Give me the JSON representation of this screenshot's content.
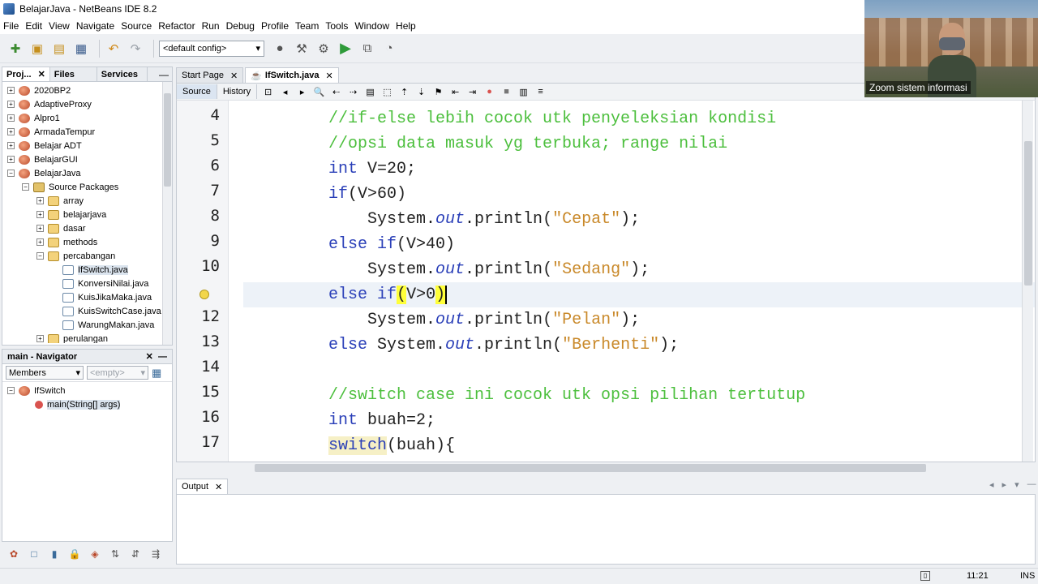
{
  "window": {
    "title": "BelajarJava - NetBeans IDE 8.2"
  },
  "menu": [
    "File",
    "Edit",
    "View",
    "Navigate",
    "Source",
    "Refactor",
    "Run",
    "Debug",
    "Profile",
    "Team",
    "Tools",
    "Window",
    "Help"
  ],
  "toolbar": {
    "config": "<default config>"
  },
  "projects_panel": {
    "tabs": [
      "Proj...",
      "Files",
      "Services"
    ],
    "tree": [
      {
        "label": "2020BP2",
        "level": 0,
        "type": "project",
        "expander": "+"
      },
      {
        "label": "AdaptiveProxy",
        "level": 0,
        "type": "project",
        "expander": "+"
      },
      {
        "label": "Alpro1",
        "level": 0,
        "type": "project",
        "expander": "+"
      },
      {
        "label": "ArmadaTempur",
        "level": 0,
        "type": "project",
        "expander": "+"
      },
      {
        "label": "Belajar ADT",
        "level": 0,
        "type": "project",
        "expander": "+"
      },
      {
        "label": "BelajarGUI",
        "level": 0,
        "type": "project",
        "expander": "+"
      },
      {
        "label": "BelajarJava",
        "level": 0,
        "type": "project",
        "expander": "−"
      },
      {
        "label": "Source Packages",
        "level": 1,
        "type": "source",
        "expander": "−"
      },
      {
        "label": "array",
        "level": 2,
        "type": "package",
        "expander": "+"
      },
      {
        "label": "belajarjava",
        "level": 2,
        "type": "package",
        "expander": "+"
      },
      {
        "label": "dasar",
        "level": 2,
        "type": "package",
        "expander": "+"
      },
      {
        "label": "methods",
        "level": 2,
        "type": "package",
        "expander": "+"
      },
      {
        "label": "percabangan",
        "level": 2,
        "type": "package",
        "expander": "−"
      },
      {
        "label": "IfSwitch.java",
        "level": 3,
        "type": "java",
        "expander": "",
        "selected": true
      },
      {
        "label": "KonversiNilai.java",
        "level": 3,
        "type": "java",
        "expander": ""
      },
      {
        "label": "KuisJikaMaka.java",
        "level": 3,
        "type": "java",
        "expander": ""
      },
      {
        "label": "KuisSwitchCase.java",
        "level": 3,
        "type": "java",
        "expander": ""
      },
      {
        "label": "WarungMakan.java",
        "level": 3,
        "type": "java",
        "expander": ""
      },
      {
        "label": "perulangan",
        "level": 2,
        "type": "package",
        "expander": "+"
      }
    ]
  },
  "navigator": {
    "title": "main - Navigator",
    "members_label": "Members",
    "filter_placeholder": "<empty>",
    "tree": [
      {
        "label": "IfSwitch",
        "level": 0
      },
      {
        "label": "main(String[] args)",
        "level": 1
      }
    ]
  },
  "editor": {
    "tabs": [
      {
        "label": "Start Page",
        "active": false
      },
      {
        "label": "IfSwitch.java",
        "active": true
      }
    ],
    "subtabs": [
      "Source",
      "History"
    ],
    "first_line": 4,
    "current_line_index": 7,
    "hint_line_index": 7,
    "lines": [
      [
        {
          "t": "//if-else lebih cocok utk penyeleksian kondisi",
          "c": "cm"
        }
      ],
      [
        {
          "t": "//opsi data masuk yg terbuka; range nilai",
          "c": "cm"
        }
      ],
      [
        {
          "t": "int",
          "c": "kw"
        },
        {
          "t": " V=20;",
          "c": ""
        }
      ],
      [
        {
          "t": "if",
          "c": "kw"
        },
        {
          "t": "(V>60)",
          "c": ""
        }
      ],
      [
        {
          "t": "    System.",
          "c": ""
        },
        {
          "t": "out",
          "c": "it"
        },
        {
          "t": ".println(",
          "c": ""
        },
        {
          "t": "\"Cepat\"",
          "c": "str"
        },
        {
          "t": ");",
          "c": ""
        }
      ],
      [
        {
          "t": "else",
          "c": "kw"
        },
        {
          "t": " ",
          "c": ""
        },
        {
          "t": "if",
          "c": "kw"
        },
        {
          "t": "(V>40)",
          "c": ""
        }
      ],
      [
        {
          "t": "    System.",
          "c": ""
        },
        {
          "t": "out",
          "c": "it"
        },
        {
          "t": ".println(",
          "c": ""
        },
        {
          "t": "\"Sedang\"",
          "c": "str"
        },
        {
          "t": ");",
          "c": ""
        }
      ],
      [
        {
          "t": "else",
          "c": "kw"
        },
        {
          "t": " ",
          "c": ""
        },
        {
          "t": "if",
          "c": "kw"
        },
        {
          "t": "(",
          "c": "hl"
        },
        {
          "t": "V>0",
          "c": ""
        },
        {
          "t": ")",
          "c": "hl caret"
        }
      ],
      [
        {
          "t": "    System.",
          "c": ""
        },
        {
          "t": "out",
          "c": "it"
        },
        {
          "t": ".println(",
          "c": ""
        },
        {
          "t": "\"Pelan\"",
          "c": "str"
        },
        {
          "t": ");",
          "c": ""
        }
      ],
      [
        {
          "t": "else",
          "c": "kw"
        },
        {
          "t": " System.",
          "c": ""
        },
        {
          "t": "out",
          "c": "it"
        },
        {
          "t": ".println(",
          "c": ""
        },
        {
          "t": "\"Berhenti\"",
          "c": "str"
        },
        {
          "t": ");",
          "c": ""
        }
      ],
      [
        {
          "t": "",
          "c": ""
        }
      ],
      [
        {
          "t": "//switch case ini cocok utk opsi pilihan tertutup",
          "c": "cm"
        }
      ],
      [
        {
          "t": "int",
          "c": "kw"
        },
        {
          "t": " buah=2;",
          "c": ""
        }
      ],
      [
        {
          "t": "switch",
          "c": "kw swhl"
        },
        {
          "t": "(buah){",
          "c": ""
        }
      ]
    ],
    "line_numbers": [
      "4",
      "5",
      "6",
      "7",
      "8",
      "9",
      "10",
      "",
      "12",
      "13",
      "14",
      "15",
      "16",
      "17"
    ]
  },
  "output": {
    "tab": "Output"
  },
  "status": {
    "position": "11:21",
    "mode": "INS"
  },
  "webcam": {
    "caption": "Zoom sistem informasi"
  }
}
